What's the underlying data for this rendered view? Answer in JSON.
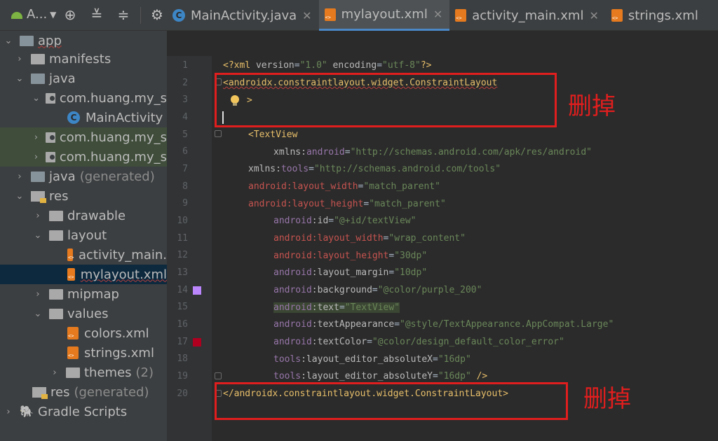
{
  "toolbar": {
    "project_label": "A...",
    "icons": [
      "locate-icon",
      "collapse-icon",
      "expand-icon",
      "gear-icon"
    ]
  },
  "tabs": [
    {
      "label": "MainActivity.java",
      "icon": "java-class-icon",
      "active": false,
      "closable": true
    },
    {
      "label": "mylayout.xml",
      "icon": "xml-file-icon",
      "active": true,
      "closable": true
    },
    {
      "label": "activity_main.xml",
      "icon": "xml-file-icon",
      "active": false,
      "closable": true
    },
    {
      "label": "strings.xml",
      "icon": "xml-file-icon",
      "active": false,
      "closable": false
    }
  ],
  "tree": {
    "app": "app",
    "manifests": "manifests",
    "java": "java",
    "pkg1": "com.huang.my_s",
    "main_activity": "MainActivity",
    "pkg2": "com.huang.my_s",
    "pkg3": "com.huang.my_s",
    "java_gen": "java",
    "java_gen_suffix": "(generated)",
    "res": "res",
    "drawable": "drawable",
    "layout": "layout",
    "activity_main": "activity_main.",
    "mylayout": "mylayout.xml",
    "mipmap": "mipmap",
    "values": "values",
    "colors": "colors.xml",
    "strings": "strings.xml",
    "themes": "themes",
    "themes_count": "(2)",
    "res_gen": "res",
    "res_gen_suffix": "(generated)",
    "gradle": "Gradle Scripts"
  },
  "editor": {
    "line_numbers": [
      "1",
      "2",
      "3",
      "4",
      "5",
      "6",
      "7",
      "8",
      "9",
      "10",
      "11",
      "12",
      "13",
      "14",
      "15",
      "16",
      "17",
      "18",
      "19",
      "20"
    ],
    "l1": {
      "open": "<?xml ",
      "a1": "version",
      "eq1": "=",
      "v1": "\"1.0\"",
      "a2": " encoding",
      "eq2": "=",
      "v2": "\"utf-8\"",
      "close": "?>"
    },
    "l2": {
      "text": "<androidx.constraintlayout.widget.ConstraintLayout"
    },
    "l3": {
      "text": ">"
    },
    "l5": {
      "text": "<TextView"
    },
    "l6": {
      "ns": "xmlns:",
      "attr": "android",
      "eq": "=",
      "val": "\"http://schemas.android.com/apk/res/android\""
    },
    "l7": {
      "ns": "xmlns:",
      "attr": "tools",
      "eq": "=",
      "val": "\"http://schemas.android.com/tools\""
    },
    "l8": {
      "attr": "android:layout_width",
      "eq": "=",
      "val": "\"match_parent\""
    },
    "l9": {
      "attr": "android:layout_height",
      "eq": "=",
      "val": "\"match_parent\""
    },
    "l10": {
      "ns": "android",
      "attr": ":id",
      "eq": "=",
      "val": "\"@+id/textView\""
    },
    "l11": {
      "attr": "android:layout_width",
      "eq": "=",
      "val": "\"wrap_content\""
    },
    "l12": {
      "attr": "android:layout_height",
      "eq": "=",
      "val": "\"30dp\""
    },
    "l13": {
      "ns": "android",
      "attr": ":layout_margin",
      "eq": "=",
      "val": "\"10dp\""
    },
    "l14": {
      "ns": "android",
      "attr": ":background",
      "eq": "=",
      "val": "\"@color/purple_200\""
    },
    "l15": {
      "ns": "android",
      "attr": ":text",
      "eq": "=",
      "val": "\"TextView\""
    },
    "l16": {
      "ns": "android",
      "attr": ":textAppearance",
      "eq": "=",
      "val": "\"@style/TextAppearance.AppCompat.Large\""
    },
    "l17": {
      "ns": "android",
      "attr": ":textColor",
      "eq": "=",
      "val": "\"@color/design_default_color_error\""
    },
    "l18": {
      "ns": "tools",
      "attr": ":layout_editor_absoluteX",
      "eq": "=",
      "val": "\"16dp\""
    },
    "l19": {
      "ns": "tools",
      "attr": ":layout_editor_absoluteY",
      "eq": "=",
      "val": "\"16dp\"",
      "close": " />"
    },
    "l20": {
      "text": "</androidx.constraintlayout.widget.ConstraintLayout>"
    }
  },
  "annotations": {
    "top": "删掉",
    "bottom": "删掉"
  },
  "colors": {
    "swatch_purple": "#bb86fc",
    "swatch_red": "#b00020",
    "annotation_red": "#e01e1e"
  }
}
